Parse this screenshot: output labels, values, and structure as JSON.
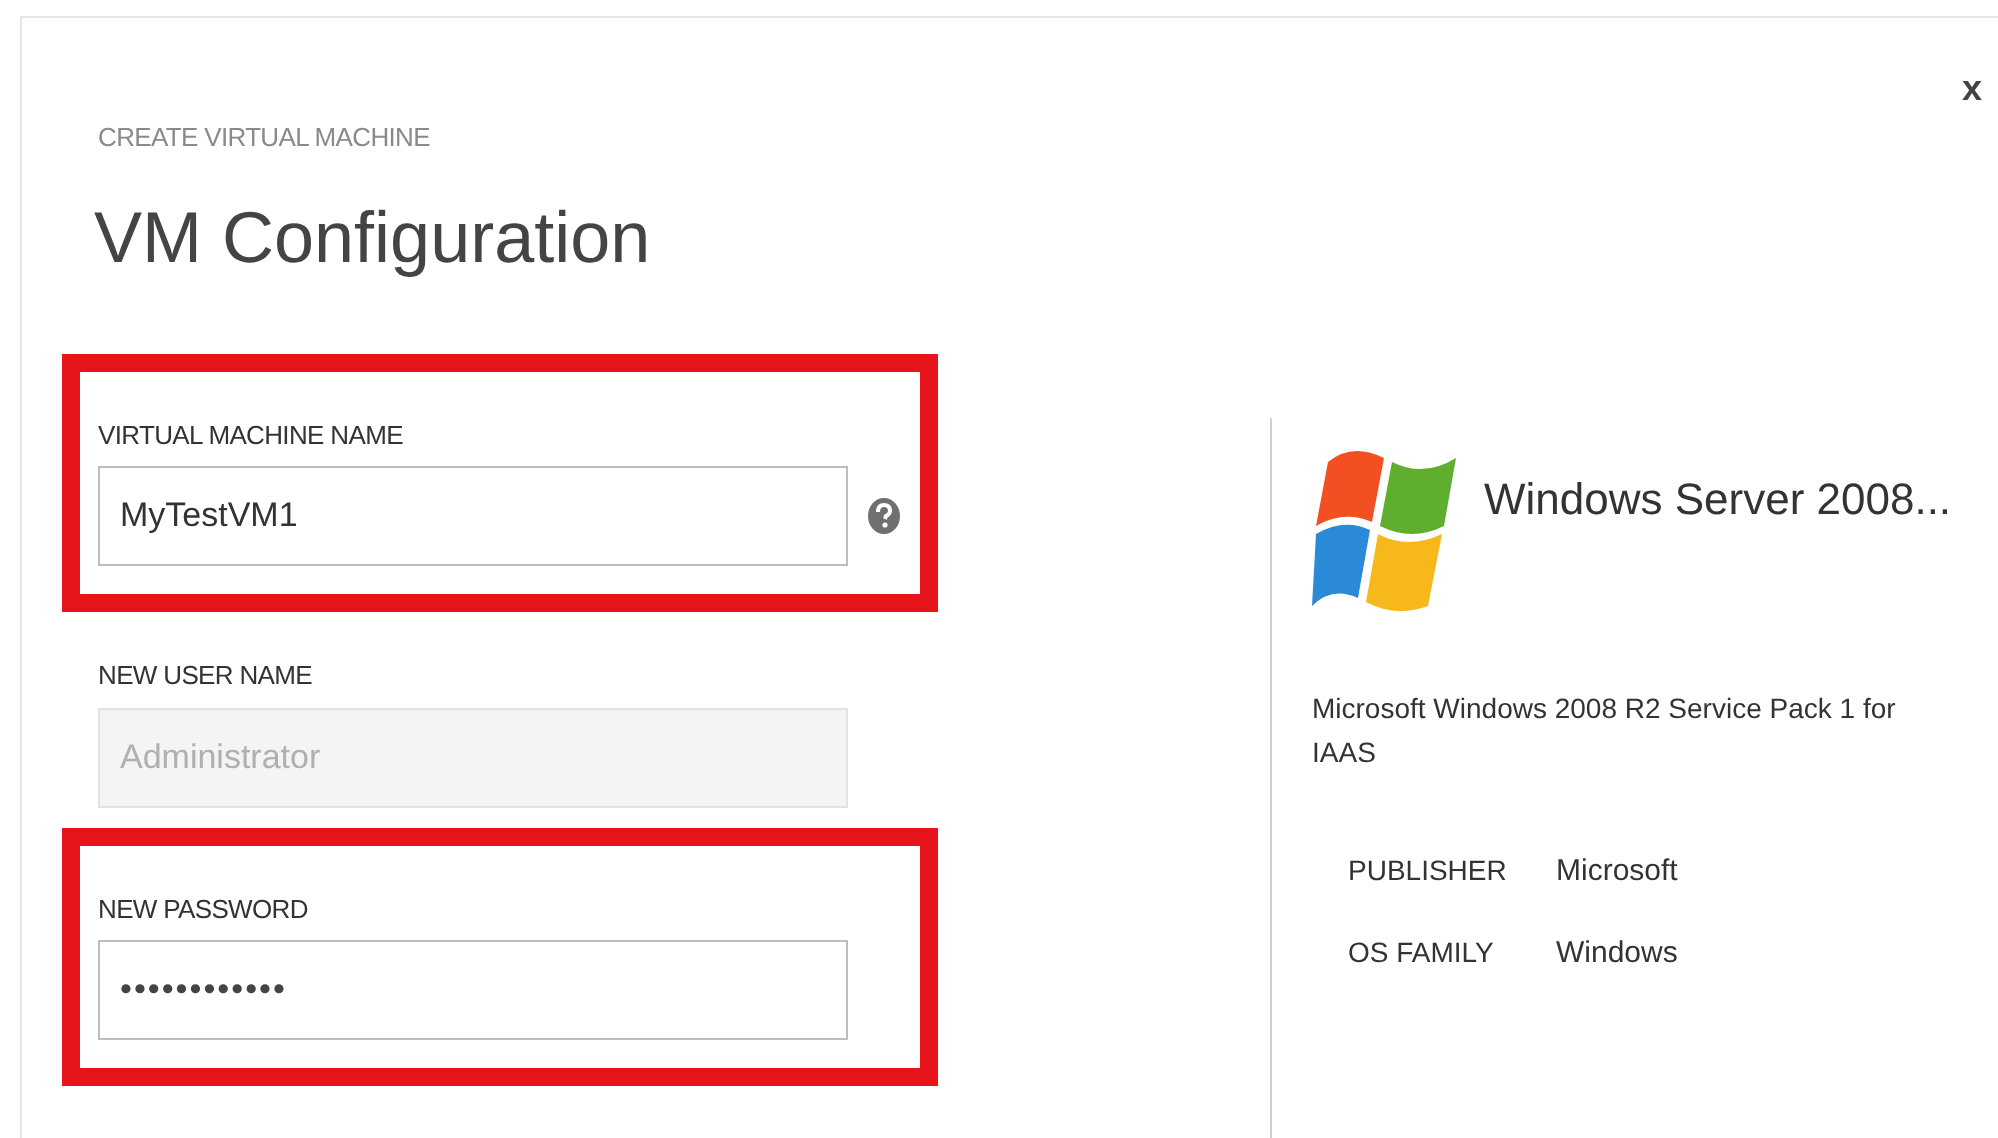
{
  "dialog": {
    "eyebrow": "CREATE VIRTUAL MACHINE",
    "title": "VM Configuration",
    "close": "x"
  },
  "fields": [
    {
      "label": "VIRTUAL MACHINE NAME",
      "value": "MyTestVM1",
      "kind": "text",
      "disabled": false,
      "highlighted": true,
      "help": true
    },
    {
      "label": "NEW USER NAME",
      "value": "Administrator",
      "kind": "text",
      "disabled": true,
      "highlighted": false,
      "help": false
    },
    {
      "label": "NEW PASSWORD",
      "value": "••••••••••••",
      "kind": "password",
      "disabled": false,
      "highlighted": true,
      "help": false
    }
  ],
  "image_info": {
    "name": "Windows Server 2008...",
    "description": "Microsoft Windows 2008 R2 Service Pack 1 for IAAS",
    "properties": [
      {
        "label": "PUBLISHER",
        "value": "Microsoft"
      },
      {
        "label": "OS FAMILY",
        "value": "Windows"
      }
    ]
  }
}
